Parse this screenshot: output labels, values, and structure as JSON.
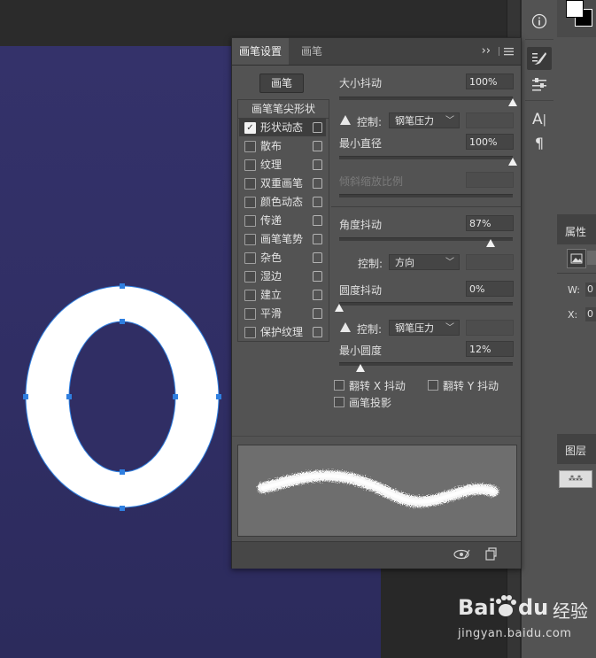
{
  "panel": {
    "tabs": [
      "画笔设置",
      "画笔"
    ],
    "brush_button": "画笔",
    "tip_shape_label": "画笔笔尖形状",
    "menu_arrows": "››",
    "list": [
      {
        "label": "形状动态",
        "checked": true,
        "selected": true
      },
      {
        "label": "散布",
        "checked": false
      },
      {
        "label": "纹理",
        "checked": false
      },
      {
        "label": "双重画笔",
        "checked": false
      },
      {
        "label": "颜色动态",
        "checked": false
      },
      {
        "label": "传递",
        "checked": false
      },
      {
        "label": "画笔笔势",
        "checked": false
      },
      {
        "label": "杂色",
        "checked": false
      },
      {
        "label": "湿边",
        "checked": false
      },
      {
        "label": "建立",
        "checked": false
      },
      {
        "label": "平滑",
        "checked": false
      },
      {
        "label": "保护纹理",
        "checked": false
      }
    ],
    "size_jitter": {
      "label": "大小抖动",
      "value": "100%",
      "fraction": 1.0
    },
    "size_control": {
      "label": "控制:",
      "value": "钢笔压力"
    },
    "min_diameter": {
      "label": "最小直径",
      "value": "100%",
      "fraction": 1.0
    },
    "tilt_scale": {
      "label": "倾斜缩放比例"
    },
    "angle_jitter": {
      "label": "角度抖动",
      "value": "87%",
      "fraction": 0.87
    },
    "angle_control": {
      "label": "控制:",
      "value": "方向"
    },
    "roundness_jitter": {
      "label": "圆度抖动",
      "value": "0%",
      "fraction": 0.0
    },
    "roundness_control": {
      "label": "控制:",
      "value": "钢笔压力"
    },
    "min_roundness": {
      "label": "最小圆度",
      "value": "12%",
      "fraction": 0.12
    },
    "flip_x": "翻转 X 抖动",
    "flip_y": "翻转 Y 抖动",
    "brush_projection": "画笔投影"
  },
  "side": {
    "properties": "属性",
    "w_label": "W:",
    "w_value": "0",
    "x_label": "X:",
    "x_value": "0",
    "layers": "图层"
  },
  "watermark": {
    "brand": "Bai",
    "brand2": "du",
    "cn": "经验",
    "url": "jingyan.baidu.com"
  },
  "colors": {
    "canvas": "#302e64",
    "panel": "#535353",
    "shape": "#ffffff",
    "path": "#2f7fe0"
  }
}
